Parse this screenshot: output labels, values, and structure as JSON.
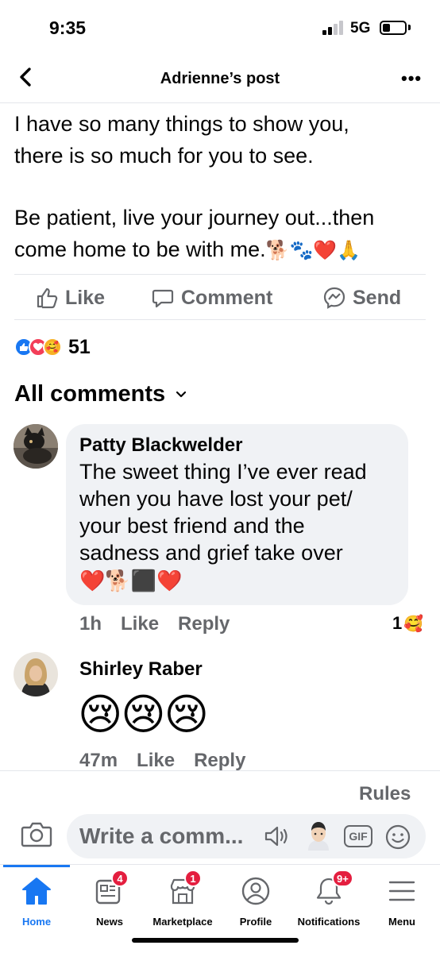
{
  "status_bar": {
    "time": "9:35",
    "network": "5G"
  },
  "header": {
    "title": "Adrienne’s post"
  },
  "post": {
    "lines": [
      "I have so many things to show you,",
      "there is so much for you to see.",
      "Be patient, live your journey out...then",
      "come home to be with me."
    ],
    "trailing_emoji": "🐕🐾❤️🙏"
  },
  "actions": {
    "like": "Like",
    "comment": "Comment",
    "send": "Send"
  },
  "reactions": {
    "icons": [
      "like-icon",
      "love-icon",
      "care-icon"
    ],
    "count": "51"
  },
  "comments_header": {
    "label": "All comments"
  },
  "comments": [
    {
      "author": "Patty Blackwelder",
      "text_lines": [
        "The sweet thing I’ve ever read",
        "when you have lost your pet/",
        "your best friend and the",
        "sadness and grief take over"
      ],
      "emoji": "❤️🐕‍⬛❤️",
      "time": "1h",
      "like": "Like",
      "reply": "Reply",
      "reaction_count": "1",
      "reaction_emoji": "🥰"
    },
    {
      "author": "Shirley Raber",
      "emoji": "😢😢😢",
      "time": "47m",
      "like": "Like",
      "reply": "Reply"
    }
  ],
  "composer": {
    "rules": "Rules",
    "placeholder": "Write a comm...",
    "gif": "GIF"
  },
  "tabs": [
    {
      "label": "Home",
      "badge": ""
    },
    {
      "label": "News",
      "badge": "4"
    },
    {
      "label": "Marketplace",
      "badge": "1"
    },
    {
      "label": "Profile",
      "badge": ""
    },
    {
      "label": "Notifications",
      "badge": "9+"
    },
    {
      "label": "Menu",
      "badge": ""
    }
  ],
  "colors": {
    "accent": "#1877f2",
    "badge": "#e41e3f",
    "muted": "#65676b",
    "bubble": "#f0f2f5"
  }
}
